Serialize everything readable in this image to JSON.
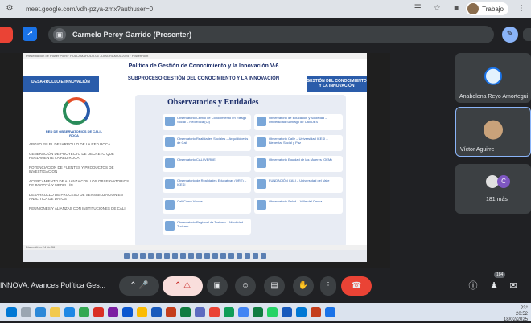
{
  "browser": {
    "url": "meet.google.com/vdh-pzya-zmx?authuser=0",
    "profile_label": "Trabajo"
  },
  "meet_header": {
    "presenter_text": "Carmelo Percy Garrido (Presenter)"
  },
  "slide": {
    "ppt_bar_text": "Presentación de Power Point  ·  HULLAMAHUDA 06 - DIAGRAMAS 2025  ·  PowerPoint",
    "title_line1": "Política de Gestión de Conocimiento y la Innovación V-6",
    "title_line2": "SUBPROCESO GESTIÓN DEL CONOCIMIENTO Y LA INNOVACIÓN",
    "band_left": "DESARROLLO E INNOVACIÓN",
    "band_right": "GESTIÓN DEL CONOCIMIENTO Y LA INNOVACIÓN",
    "logo_caption": "RED DE OBSERVATORIOS DE CALI - ROCA",
    "left_items": [
      "APOYO EN EL DESARROLLO DE LA RED ROCA",
      "GENERACIÓN DE PROYECTO DE DECRETO QUE REGLAMENTE LA RED ROCA",
      "POTENCIACIÓN DE FUENTES Y PRODUCTOS DE INVESTIGACIÓN",
      "ACERCAMIENTO DE ALIANZA CON LOS OBSERVATORIOS DE BOGOTÁ Y MEDELLÍN",
      "DESARROLLO DE PROCESO DE SENSIBILIZACIÓN EN ANALÍTICA DE DATOS",
      "REUNIONES Y ALIANZAS CON INSTITUCIONES DE CALI"
    ],
    "panel_title": "Observatorios y Entidades",
    "cards": [
      "Observatorio Centro de Conocimiento en Riesgo Social – Red Roca (CI)",
      "Observatorio de Educación y Sociedad – Universidad Santiago de Cali OES",
      "Observatorio Realidades Sociales – Arquidiócesis de Cali",
      "Observatorio Calle – Universidad ICESI – Bienestar Social y Paz",
      "Observatorio CALI VERDE",
      "Observatorio Equidad de las Mujeres (OEM)",
      "Observatorio de Realidades Educativas (ORE) – ICESI",
      "FUNDACIÓN CALI – Universidad del Valle",
      "Cali Cómo Vamos",
      "Observatorio Regional de Turismo – Movilidad Turismo",
      "Observatorio Salud – Valle del Cauca"
    ],
    "status_left": "Diapositiva 24 de 36"
  },
  "participants": [
    {
      "name": "Anabolena Reyo Amortegui"
    },
    {
      "name": "Víctor Aguirre"
    },
    {
      "name": "181 más"
    }
  ],
  "more_avatar_letter": "C",
  "bottom": {
    "meeting_name": "INNOVA: Avances Política Ges...",
    "badge_count": "184"
  },
  "taskbar": {
    "temp": "23°",
    "time": "20:52",
    "date": "18/02/2025"
  }
}
